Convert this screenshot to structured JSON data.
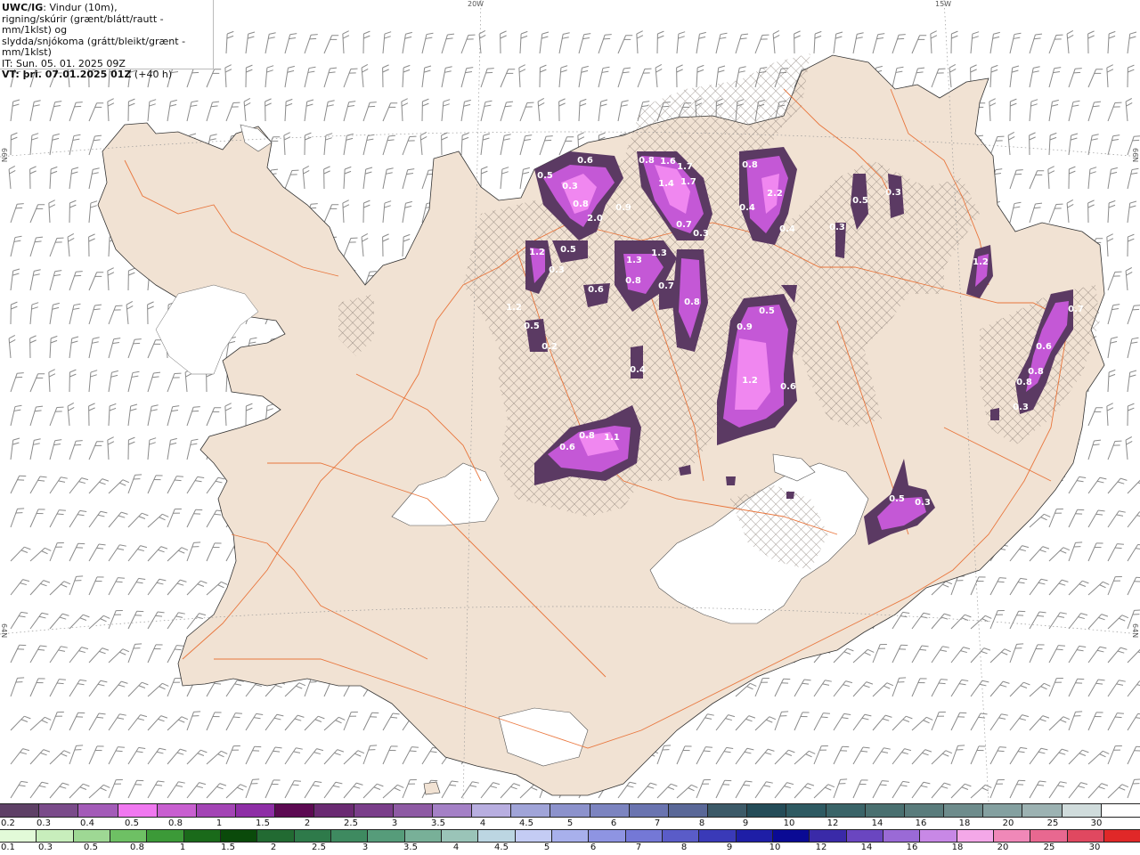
{
  "header": {
    "model": "UWC/IG",
    "line1_rest": ": Vindur (10m),",
    "line2": "rigning/skúrir (grænt/blátt/rautt - mm/1klst) og",
    "line3": "slydda/snjókoma (grátt/bleikt/grænt - mm/1klst)",
    "it": "IT: Sun. 05. 01. 2025 09Z",
    "vt": "VT: þri. 07.01.2025 01Z",
    "vt_suffix": " (+40 h)"
  },
  "graticule": {
    "lon_labels": [
      "20W",
      "15W"
    ],
    "lat_labels_left": [
      "66N",
      "64N"
    ],
    "lat_labels_right": [
      "66N",
      "64N"
    ]
  },
  "colors": {
    "land": "#f1e2d3",
    "glacier": "#ffffff",
    "roads": "#e86a2c",
    "snow_dark": "#5b3a63",
    "snow_mid": "#9a3fb5",
    "snow_light": "#e070ec",
    "snow_brightest": "#ff88ff",
    "hatch": "#7c7068",
    "wind_barb": "#7a7a7a"
  },
  "precip_labels": [
    "0.6",
    "0.5",
    "0.3",
    "0.8",
    "2.0",
    "0.9",
    "1.2",
    "0.5",
    "0.3",
    "0.8",
    "1.6",
    "1.7",
    "1.4",
    "1.7",
    "0.7",
    "0.3",
    "0.8",
    "2.2",
    "0.4",
    "0.4",
    "0.5",
    "0.3",
    "1.3",
    "0.8",
    "0.6",
    "0.7",
    "0.8",
    "1.3",
    "1.2",
    "0.5",
    "0.9",
    "1.2",
    "0.6",
    "0.5",
    "0.2",
    "0.4",
    "0.8",
    "1.1",
    "0.6",
    "0.5",
    "0.3",
    "0.7",
    "0.6",
    "0.8",
    "0.8",
    "0.3",
    "1.2",
    "0.3"
  ],
  "legend_snow": {
    "colors": [
      "#5e4066",
      "#7a4b8a",
      "#a35bb8",
      "#f078f0",
      "#c85fd0",
      "#a344b5",
      "#8e2ea6",
      "#5c0a52",
      "#6a2a72",
      "#7a3e8a",
      "#8e5aa4",
      "#a480c6",
      "#b8aee0",
      "#a0a4d8",
      "#8c92cc",
      "#7c84c0",
      "#6a74b0",
      "#5a6898",
      "#3c5a68",
      "#244c58",
      "#2e5a62",
      "#3a6468",
      "#4a7070",
      "#5a7c7c",
      "#6e8c8c",
      "#84a0a0",
      "#9cb2b2",
      "#d0dcdc",
      "#ffffff"
    ],
    "labels": [
      "0.2",
      "0.3",
      "0.4",
      "0.5",
      "0.8",
      "1",
      "1.5",
      "2",
      "2.5",
      "3",
      "3.5",
      "4",
      "4.5",
      "5",
      "6",
      "7",
      "8",
      "9",
      "10",
      "12",
      "14",
      "16",
      "18",
      "20",
      "25",
      "30"
    ]
  },
  "legend_rain": {
    "colors": [
      "#e2fad8",
      "#c8eebc",
      "#9ed894",
      "#6ec064",
      "#3c9a38",
      "#1a6a1a",
      "#0a4a0a",
      "#226a32",
      "#2e7a4a",
      "#3e8a60",
      "#569c7a",
      "#78b098",
      "#9ac4b8",
      "#bcd6e2",
      "#c4ccf4",
      "#a8b0ec",
      "#8e94e2",
      "#7478d6",
      "#5a5cc8",
      "#3a3ab8",
      "#1e1ea6",
      "#0a0a94",
      "#3a2aa8",
      "#6a46c0",
      "#9a6ad6",
      "#c888e6",
      "#f4a8e8",
      "#f088b8",
      "#e86890",
      "#e04860",
      "#e02828"
    ],
    "labels": [
      "0.1",
      "0.3",
      "0.5",
      "0.8",
      "1",
      "1.5",
      "2",
      "2.5",
      "3",
      "3.5",
      "4",
      "4.5",
      "5",
      "6",
      "7",
      "8",
      "9",
      "10",
      "12",
      "14",
      "16",
      "18",
      "20",
      "25",
      "30"
    ]
  }
}
